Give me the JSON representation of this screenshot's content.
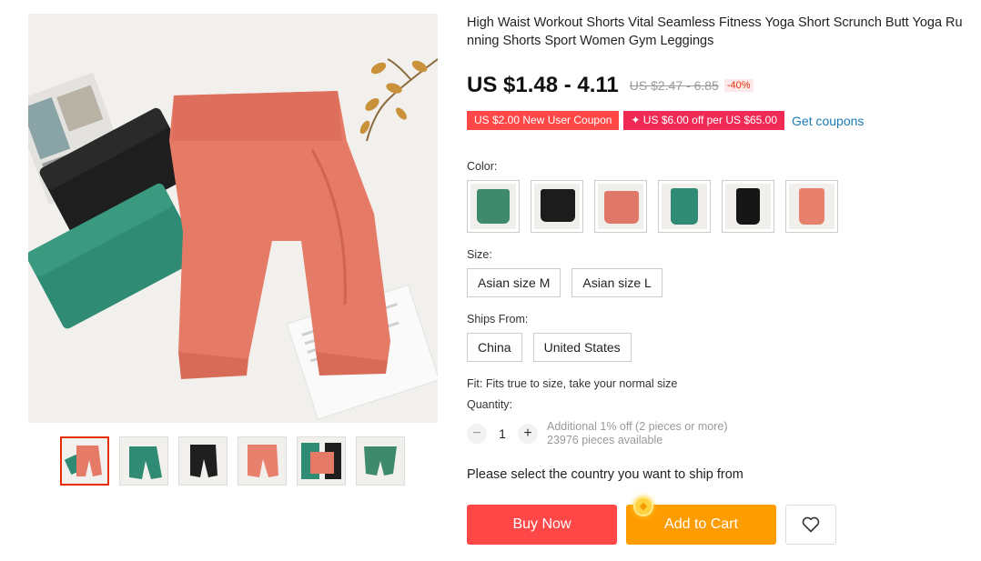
{
  "product": {
    "title": "High Waist Workout Shorts Vital Seamless Fitness Yoga Short Scrunch Butt Yoga Running Shorts Sport Women Gym Leggings",
    "price": "US $1.48 - 4.11",
    "original_price": "US $2.47 - 6.85",
    "discount": "-40%"
  },
  "coupons": {
    "new_user": "US $2.00 New User Coupon",
    "store": "✦ US $6.00 off per US $65.00",
    "get_coupons": "Get coupons"
  },
  "color": {
    "label": "Color:",
    "options": [
      {
        "name": "green",
        "color": "#3f8a6f"
      },
      {
        "name": "black",
        "color": "#1c1c1c"
      },
      {
        "name": "pink",
        "color": "#e0786a"
      },
      {
        "name": "teal",
        "color": "#2f8b73"
      },
      {
        "name": "black",
        "color": "#161616"
      },
      {
        "name": "pink",
        "color": "#e8806e"
      }
    ]
  },
  "size": {
    "label": "Size:",
    "options": [
      "Asian size M",
      "Asian size L"
    ]
  },
  "ships_from": {
    "label": "Ships From:",
    "options": [
      "China",
      "United States"
    ]
  },
  "fit": "Fit: Fits true to size, take your normal size",
  "quantity": {
    "label": "Quantity:",
    "minus": "−",
    "value": "1",
    "plus": "+",
    "additional": "Additional 1% off (2 pieces or more)",
    "available": "23976 pieces available"
  },
  "ship_message": "Please select the country you want to ship from",
  "actions": {
    "buy_now": "Buy Now",
    "add_to_cart": "Add to Cart"
  },
  "gallery": {
    "thumbnails": [
      "pink shorts",
      "green shorts",
      "black shorts",
      "pink shorts",
      "multi shorts",
      "green shorts"
    ],
    "active_index": 0
  },
  "colors": {
    "accent_red": "#ff4747",
    "cart_orange": "#ff9c00",
    "link_blue": "#1b7cb4",
    "coral": "#e57a67",
    "black": "#1f1f1f",
    "green": "#2f8b73"
  }
}
